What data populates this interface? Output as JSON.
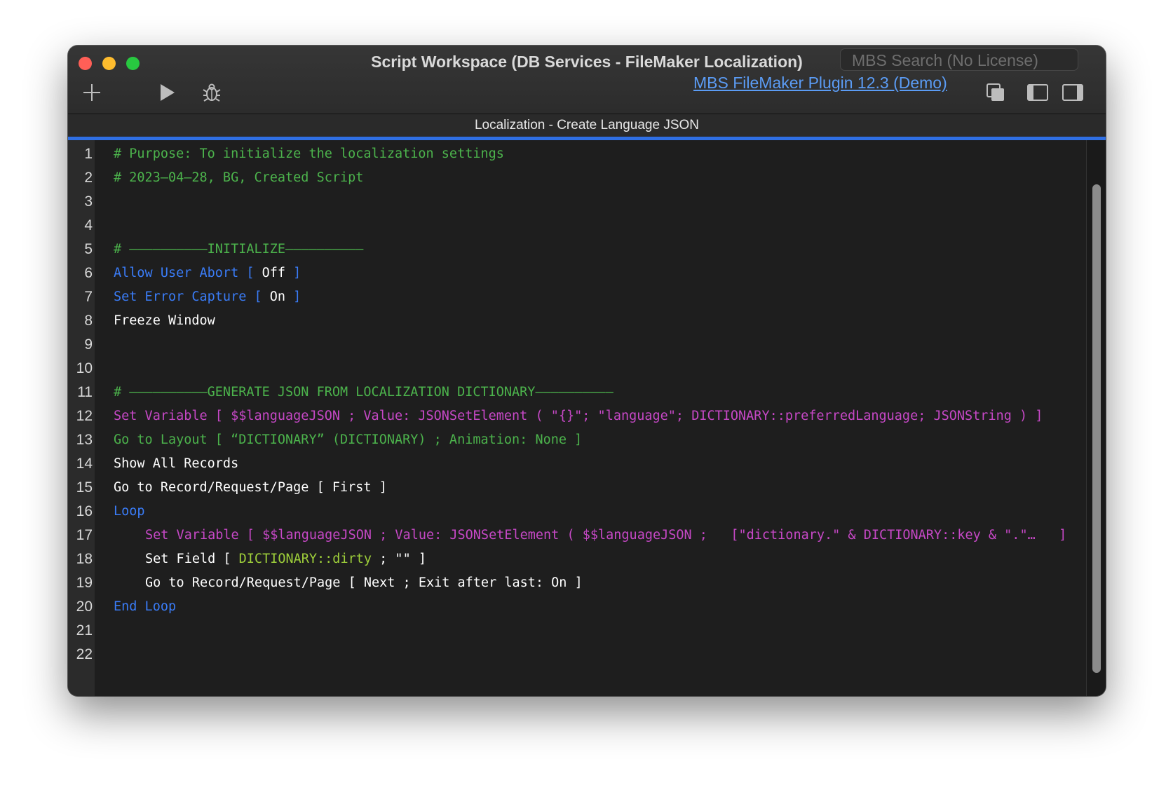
{
  "window": {
    "title": "Script Workspace (DB Services - FileMaker Localization)",
    "search_placeholder": "MBS Search (No License)",
    "plugin_link": "MBS FileMaker Plugin 12.3 (Demo)",
    "script_tab": "Localization - Create Language JSON"
  },
  "toolbar": {
    "icons": [
      "plus-icon",
      "play-icon",
      "bug-icon",
      "copy-windows-icon",
      "left-sidebar-icon",
      "right-sidebar-icon"
    ]
  },
  "colors": {
    "comment": "#4cb34c",
    "control": "#3a7cf7",
    "variable": "#c648c6",
    "field": "#9ecf3a",
    "accent": "#2f6fe4"
  },
  "lines": [
    {
      "n": "1",
      "segs": [
        {
          "t": "# Purpose: To initialize the localization settings",
          "c": "comment"
        }
      ]
    },
    {
      "n": "2",
      "segs": [
        {
          "t": "# 2023–04–28, BG, Created Script",
          "c": "comment"
        }
      ]
    },
    {
      "n": "3",
      "segs": []
    },
    {
      "n": "4",
      "segs": []
    },
    {
      "n": "5",
      "segs": [
        {
          "t": "# ––––––––––INITIALIZE––––––––––",
          "c": "comment"
        }
      ]
    },
    {
      "n": "6",
      "segs": [
        {
          "t": "Allow User Abort [ ",
          "c": "blue"
        },
        {
          "t": "Off",
          "c": "white"
        },
        {
          "t": " ]",
          "c": "blue"
        }
      ]
    },
    {
      "n": "7",
      "segs": [
        {
          "t": "Set Error Capture [ ",
          "c": "blue"
        },
        {
          "t": "On",
          "c": "white"
        },
        {
          "t": " ]",
          "c": "blue"
        }
      ]
    },
    {
      "n": "8",
      "segs": [
        {
          "t": "Freeze Window",
          "c": "white"
        }
      ]
    },
    {
      "n": "9",
      "segs": []
    },
    {
      "n": "10",
      "segs": []
    },
    {
      "n": "11",
      "segs": [
        {
          "t": "# ––––––––––GENERATE JSON FROM LOCALIZATION DICTIONARY––––––––––",
          "c": "comment"
        }
      ]
    },
    {
      "n": "12",
      "segs": [
        {
          "t": "Set Variable [ $$languageJSON ; Value: JSONSetElement ( \"{}\"; \"language\"; DICTIONARY::preferredLanguage; JSONString ) ]",
          "c": "magenta"
        }
      ]
    },
    {
      "n": "13",
      "segs": [
        {
          "t": "Go to Layout [ “DICTIONARY” (DICTIONARY) ; Animation: None ]",
          "c": "green"
        }
      ]
    },
    {
      "n": "14",
      "segs": [
        {
          "t": "Show All Records",
          "c": "white"
        }
      ]
    },
    {
      "n": "15",
      "segs": [
        {
          "t": "Go to Record/Request/Page [ First ]",
          "c": "white"
        }
      ]
    },
    {
      "n": "16",
      "segs": [
        {
          "t": "Loop",
          "c": "blue"
        }
      ]
    },
    {
      "n": "17",
      "indent": true,
      "segs": [
        {
          "t": "Set Variable [ $$languageJSON ; Value: JSONSetElement ( $$languageJSON ;   [\"dictionary.\" & DICTIONARY::key & \".\"…   ]",
          "c": "magenta"
        }
      ]
    },
    {
      "n": "18",
      "indent": true,
      "segs": [
        {
          "t": "Set Field [ ",
          "c": "white"
        },
        {
          "t": "DICTIONARY::dirty",
          "c": "lgreen"
        },
        {
          "t": " ; \"\" ]",
          "c": "white"
        }
      ]
    },
    {
      "n": "19",
      "indent": true,
      "segs": [
        {
          "t": "Go to Record/Request/Page [ Next ; Exit after last: On ]",
          "c": "white"
        }
      ]
    },
    {
      "n": "20",
      "segs": [
        {
          "t": "End Loop",
          "c": "blue"
        }
      ]
    },
    {
      "n": "21",
      "segs": []
    },
    {
      "n": "22",
      "segs": []
    }
  ]
}
